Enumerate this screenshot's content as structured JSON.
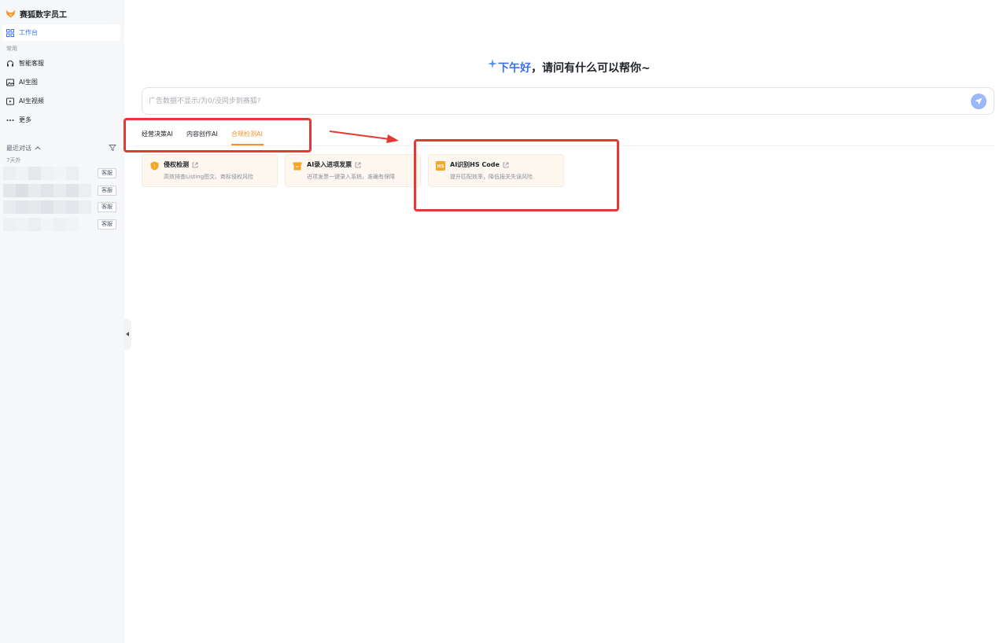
{
  "app": {
    "name": "赛狐数字员工"
  },
  "sidebar": {
    "workbench_label": "工作台",
    "common_section": "常用",
    "items": [
      {
        "label": "智能客服",
        "icon": "headset-icon"
      },
      {
        "label": "AI生图",
        "icon": "image-icon"
      },
      {
        "label": "AI生视频",
        "icon": "video-icon"
      },
      {
        "label": "更多",
        "icon": "more-icon"
      }
    ],
    "recent": {
      "title": "最近对话",
      "group_label": "7天外",
      "conversations": [
        {
          "tag": "客服"
        },
        {
          "tag": "客服"
        },
        {
          "tag": "客服"
        },
        {
          "tag": "客服"
        }
      ]
    }
  },
  "main": {
    "greeting_highlight": "下午好",
    "greeting_rest": "，请问有什么可以帮你~",
    "search_placeholder": "广告数据不显示/为0/没同步到赛狐?",
    "tabs": [
      {
        "label": "经营决策AI",
        "active": false
      },
      {
        "label": "内容创作AI",
        "active": false
      },
      {
        "label": "合规检测AI",
        "active": true
      }
    ],
    "cards": [
      {
        "title": "侵权检测",
        "desc": "高效排查Listing图文、商标侵权风险",
        "icon": "shield-icon"
      },
      {
        "title": "AI录入进项发票",
        "desc": "进项发票一键录入系统，准确有保障",
        "icon": "invoice-icon"
      },
      {
        "title": "AI识别HS Code",
        "desc": "提升匹配效率，降低报关失误风险",
        "icon": "hs-code-icon"
      }
    ]
  },
  "colors": {
    "accent_blue": "#3b6ff5",
    "accent_orange": "#f0932b",
    "annotation_red": "#e53935"
  }
}
